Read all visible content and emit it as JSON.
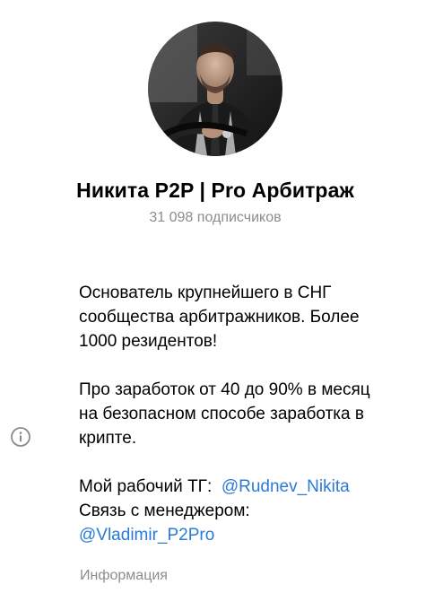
{
  "channel": {
    "name": "Никита P2P | Pro Арбитраж",
    "subscribers": "31 098 подписчиков"
  },
  "about": {
    "line1": "Основатель крупнейшего в СНГ",
    "line2": "сообщества арбитражников. Более",
    "line3": "1000 резидентов!",
    "line4": "Про заработок от 40 до 90% в месяц",
    "line5": "на безопасном способе заработка в",
    "line6": "крипте.",
    "work_prefix": "Мой рабочий ТГ:",
    "work_link": "@Rudnev_Nikita",
    "manager_text": "Связь с менеджером:",
    "manager_link": "@Vladimir_P2Pro"
  },
  "info_label": "Информация",
  "icons": {
    "info": "info-circle-icon",
    "avatar": "channel-avatar"
  },
  "colors": {
    "link": "#2a7bd6",
    "secondary_text": "#8c8c8c",
    "icon": "#8a8a8a"
  }
}
